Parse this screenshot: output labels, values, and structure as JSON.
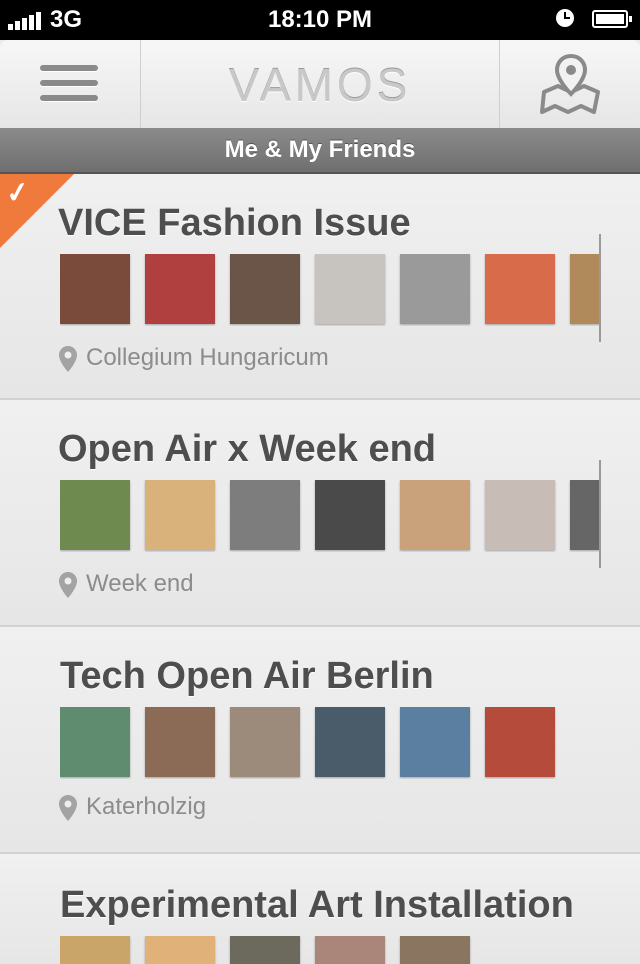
{
  "status_bar": {
    "network": "3G",
    "time": "18:10 PM"
  },
  "header": {
    "title": "VAMOS"
  },
  "filter": {
    "label": "Me & My Friends"
  },
  "events": [
    {
      "title": "VICE Fashion Issue",
      "location": "Collegium Hungaricum",
      "selected": true,
      "avatars": [
        "#7a4a3a",
        "#b0403f",
        "#6b5548",
        "#c7c4c0",
        "#9a9a9a",
        "#d86b49",
        "#b08a5a"
      ]
    },
    {
      "title": "Open Air x Week end",
      "location": "Week end",
      "selected": false,
      "avatars": [
        "#6e8a4f",
        "#d8b27a",
        "#7d7d7d",
        "#4a4a4a",
        "#c9a27b",
        "#c8bdb6",
        "#666"
      ]
    },
    {
      "title": "Tech Open Air Berlin",
      "location": "Katerholzig",
      "selected": false,
      "avatars": [
        "#5f8c6e",
        "#8b6b55",
        "#9c8a7a",
        "#4a5b6a",
        "#5b7fa0",
        "#b54b3a"
      ]
    },
    {
      "title": "Experimental Art Installation",
      "location": "",
      "selected": false,
      "avatars": [
        "#c9a56a",
        "#e0b27a",
        "#6c6a5d",
        "#a9857a",
        "#8a7560"
      ]
    }
  ],
  "icons": {
    "menu": "hamburger-icon",
    "map": "map-pin-icon",
    "location": "location-pin-icon",
    "check": "checkmark-icon"
  }
}
